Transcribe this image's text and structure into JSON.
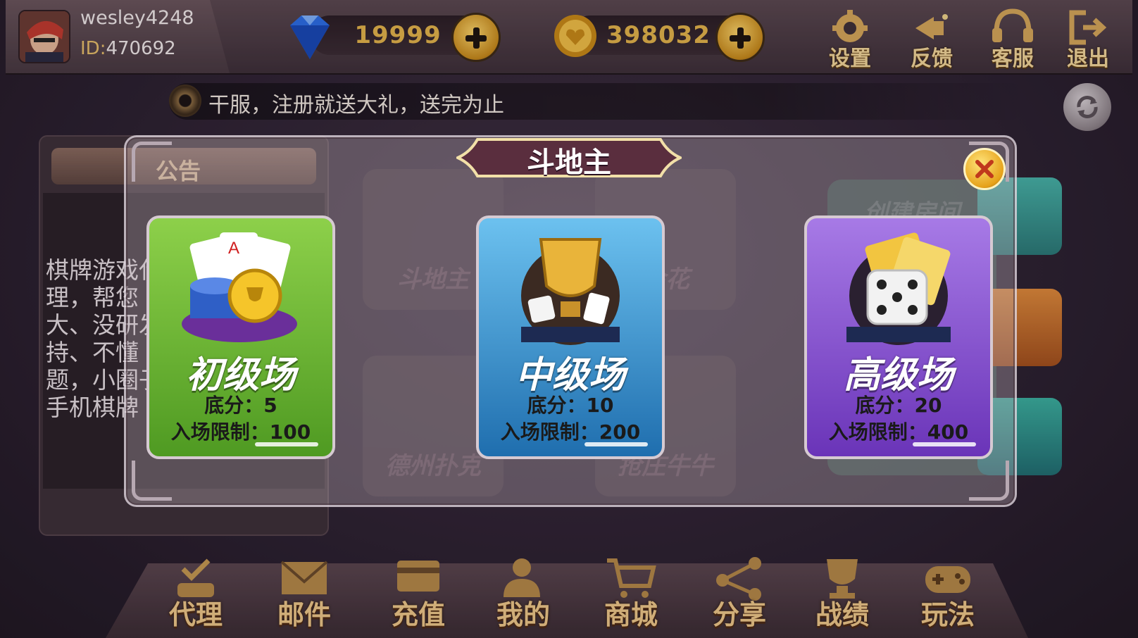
{
  "user": {
    "name": "wesley4248",
    "id_label": "ID:",
    "id_value": "470692"
  },
  "resources": {
    "diamonds": "19999",
    "coins": "398032"
  },
  "topbar": {
    "settings": "设置",
    "feedback": "反馈",
    "service": "客服",
    "logout": "退出"
  },
  "marquee": {
    "text": "干服，注册就送大礼，送完为止"
  },
  "notice": {
    "title": "公告",
    "body_lines": [
      "棋牌游戏代",
      "理，帮您",
      "大、没研发",
      " 持、不懂",
      "题，小圈子",
      " 手机棋牌"
    ]
  },
  "background_tiles": [
    "斗地主",
    "金花",
    "德州扑克",
    "抢庄牛牛",
    "创建房间"
  ],
  "modal": {
    "title": "斗地主",
    "rooms": [
      {
        "name": "初级场",
        "base_label": "底分：",
        "base": "5",
        "limit_label": "入场限制：",
        "limit": "100",
        "color": "#6cb030"
      },
      {
        "name": "中级场",
        "base_label": "底分：",
        "base": "10",
        "limit_label": "入场限制：",
        "limit": "200",
        "color": "#3d9ad6"
      },
      {
        "name": "高级场",
        "base_label": "底分：",
        "base": "20",
        "limit_label": "入场限制：",
        "limit": "400",
        "color": "#7e4cc6"
      }
    ]
  },
  "bottom_nav": [
    "代理",
    "邮件",
    "充值",
    "我的",
    "商城",
    "分享",
    "战绩",
    "玩法"
  ],
  "colors": {
    "gold": "#e5b64a",
    "label": "#f0c98a"
  }
}
